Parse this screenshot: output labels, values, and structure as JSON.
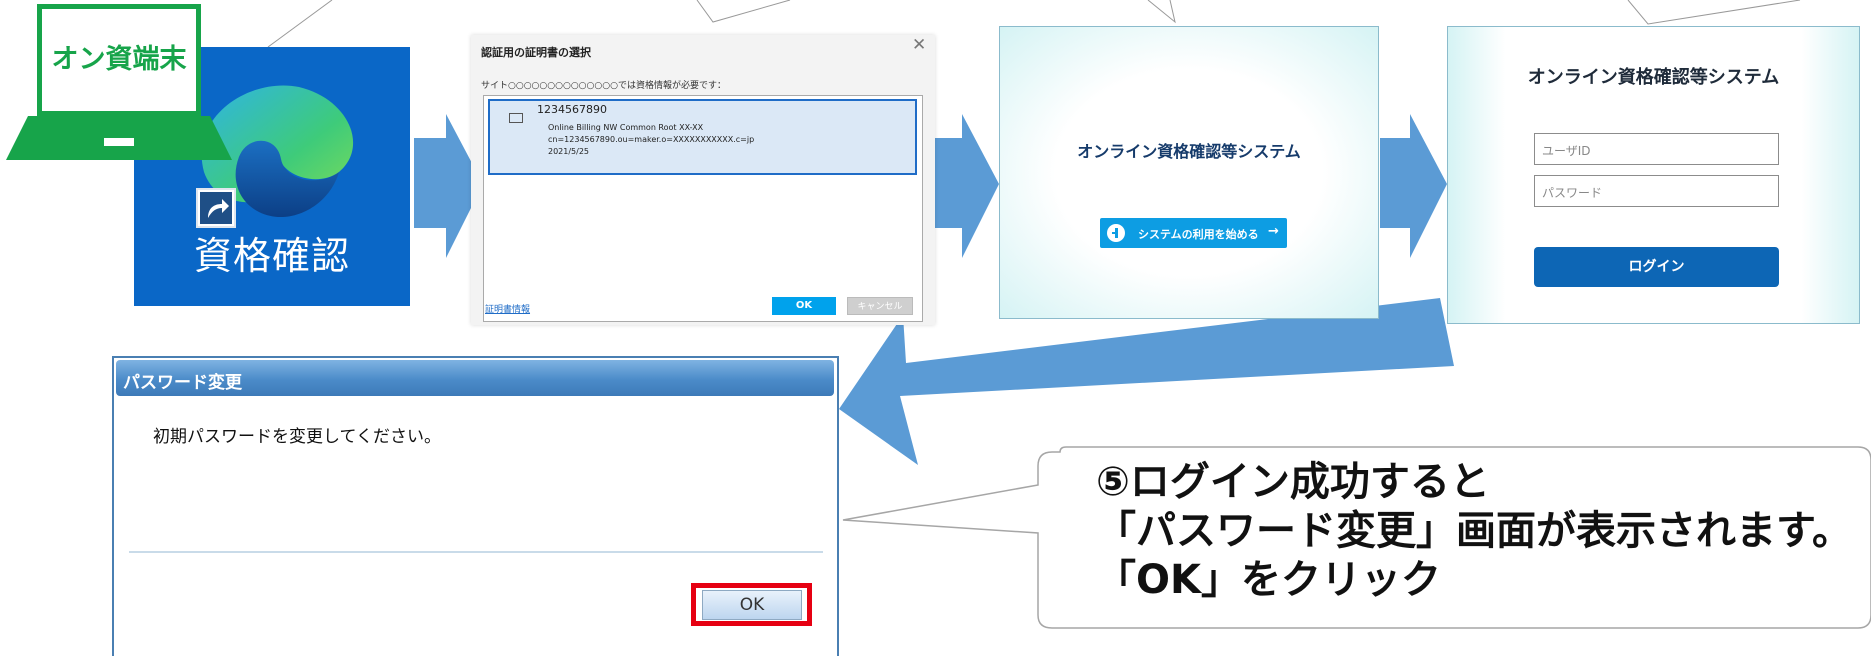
{
  "step1": {
    "terminal_label": "オン資端末",
    "shortcut_label": "資格確認",
    "icon": "edge-browser-icon"
  },
  "cert_dialog": {
    "title": "認証用の証明書の選択",
    "site_text": "サイト○○○○○○○○○○○○○○では資格情報が必要です：",
    "certificate": {
      "id": "1234567890",
      "line1": "Online Billing NW Common Root XX-XX",
      "line2": "cn=1234567890.ou=maker.o=XXXXXXXXXXX.c=jp",
      "line3": "2021/5/25"
    },
    "link": "証明書情報",
    "ok": "OK",
    "cancel": "キャンセル"
  },
  "splash": {
    "title": "オンライン資格確認等システム",
    "start_button": "システムの利用を始める",
    "arrow": "→"
  },
  "login": {
    "title": "オンライン資格確認等システム",
    "user_placeholder": "ユーザID",
    "password_placeholder": "パスワード",
    "button": "ログイン"
  },
  "password_dialog": {
    "title": "パスワード変更",
    "message": "初期パスワードを変更してください。",
    "ok": "OK"
  },
  "callout": {
    "line1": "⑤ログイン成功すると",
    "line2": "「パスワード変更」画面が表示されます。",
    "line3": "「OK」をクリック"
  },
  "colors": {
    "arrow": "#5b9bd5",
    "edge_tile": "#0a67c7",
    "terminal_green": "#17a44a",
    "highlight_red": "#e60012"
  }
}
